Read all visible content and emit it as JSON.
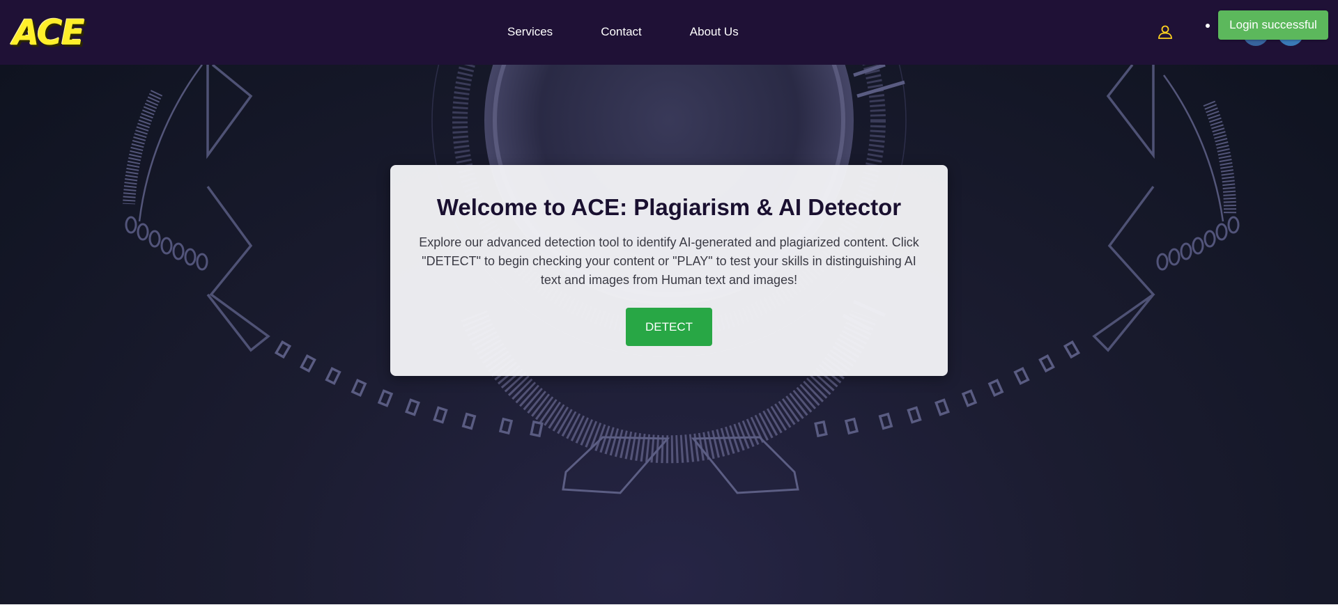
{
  "header": {
    "logo_text": "ACE",
    "nav": [
      {
        "label": "Services"
      },
      {
        "label": "Contact"
      },
      {
        "label": "About Us"
      }
    ],
    "user_icon": "user-icon"
  },
  "toast": {
    "message": "Login successful"
  },
  "hero": {
    "title": "Welcome to ACE: Plagiarism & AI Detector",
    "description": "Explore our advanced detection tool to identify AI-generated and plagiarized content. Click \"DETECT\" to begin checking your content or \"PLAY\" to test your skills in distinguishing AI text and images from Human text and images!",
    "detect_label": "DETECT"
  },
  "colors": {
    "navbar_bg": "#1f1136",
    "logo": "#ffef2a",
    "detect_button": "#28a745",
    "toast_bg": "#5cb85c",
    "hero_bg": "#1b1c30"
  }
}
